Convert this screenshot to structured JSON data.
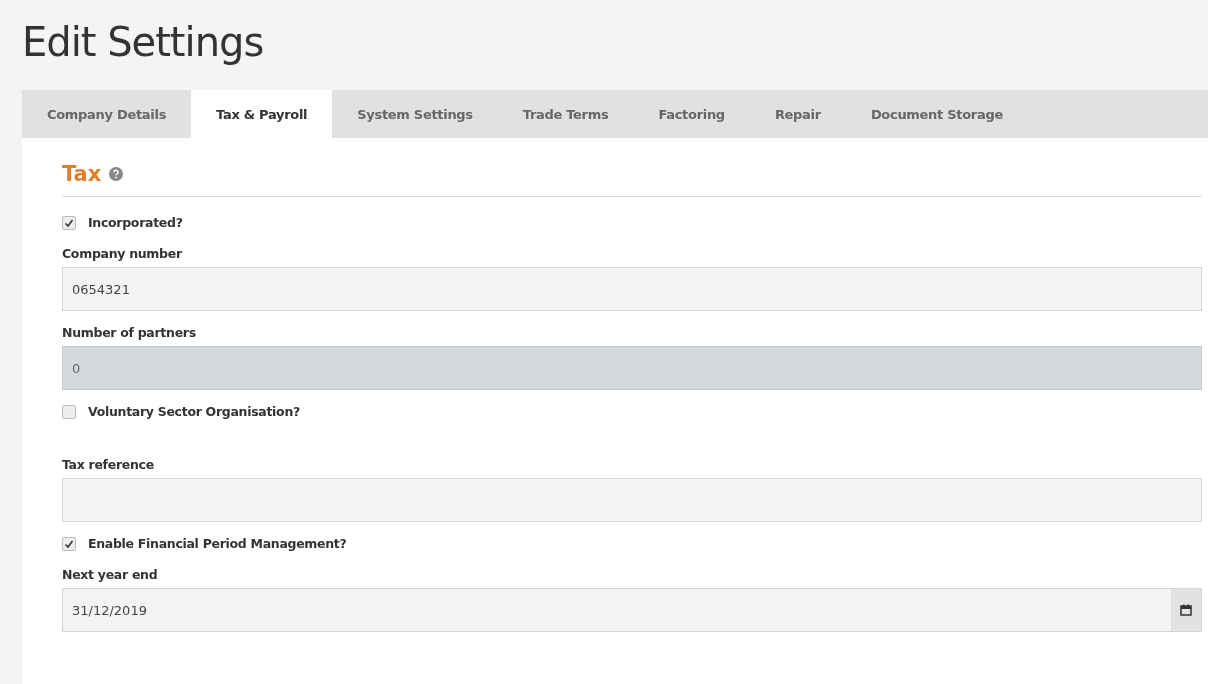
{
  "page_title": "Edit Settings",
  "tabs": [
    {
      "label": "Company Details",
      "selected": false
    },
    {
      "label": "Tax & Payroll",
      "selected": true
    },
    {
      "label": "System Settings",
      "selected": false
    },
    {
      "label": "Trade Terms",
      "selected": false
    },
    {
      "label": "Factoring",
      "selected": false
    },
    {
      "label": "Repair",
      "selected": false
    },
    {
      "label": "Document Storage",
      "selected": false
    }
  ],
  "section": {
    "title": "Tax"
  },
  "items": [
    {
      "kind": "checkbox",
      "label": "Incorporated?",
      "checked": true
    },
    {
      "kind": "field",
      "label": "Company number",
      "value": "0654321",
      "disabled": false
    },
    {
      "kind": "field",
      "label": "Number of partners",
      "value": "0",
      "disabled": true
    },
    {
      "kind": "checkbox",
      "label": "Voluntary Sector Organisation?",
      "checked": false
    },
    {
      "kind": "field",
      "label": "Tax reference",
      "disabled": false
    },
    {
      "kind": "checkbox",
      "label": "Enable Financial Period Management?",
      "checked": true
    },
    {
      "kind": "date",
      "label": "Next year end",
      "value": "31/12/2019",
      "disabled": false
    }
  ]
}
